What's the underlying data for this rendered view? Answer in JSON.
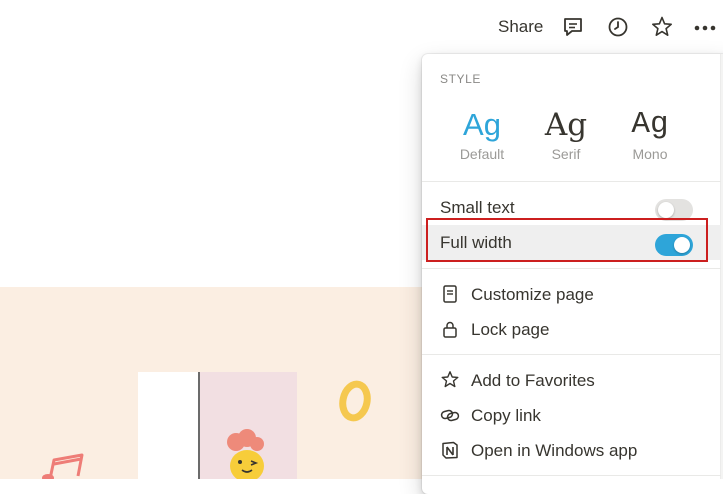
{
  "topbar": {
    "share_label": "Share",
    "icons": [
      "comment-icon",
      "clock-icon",
      "star-icon",
      "more-icon"
    ]
  },
  "menu": {
    "style_heading": "STYLE",
    "fonts": [
      {
        "sample": "Ag",
        "label": "Default",
        "selected": true
      },
      {
        "sample": "Ag",
        "label": "Serif",
        "selected": false
      },
      {
        "sample": "Ag",
        "label": "Mono",
        "selected": false
      }
    ],
    "small_text": {
      "label": "Small text",
      "on": false
    },
    "full_width": {
      "label": "Full width",
      "on": true
    },
    "customize_page": "Customize page",
    "lock_page": "Lock page",
    "add_to_favorites": "Add to Favorites",
    "copy_link": "Copy link",
    "open_in_app": "Open in Windows app"
  },
  "colors": {
    "accent": "#2ea5d9",
    "highlight_border": "#cc1f1f",
    "cover_bg": "#fbeee2"
  }
}
